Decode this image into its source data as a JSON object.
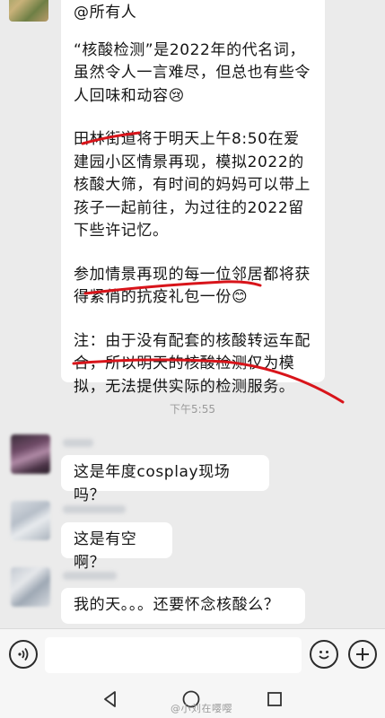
{
  "messages": {
    "announcement": {
      "mention": "@所有人",
      "para1": "“核酸检测”是2022年的代名词，虽然令人一言难尽，但总也有些令人回味和动容😢",
      "para2": "田林街道将于明天上午8:50在爱建园小区情景再现，模拟2022的核酸大筛，有时间的妈妈可以带上孩子一起前往，为过往的2022留下些许记忆。",
      "para3": "参加情景再现的每一位邻居都将获得紧俏的抗疫礼包一份😊",
      "para4": "注：由于没有配套的核酸转运车配合，所以明天的核酸检测仅为模拟，无法提供实际的检测服务。"
    },
    "time_separator": "下午5:55",
    "replies": [
      {
        "text": "这是年度cosplay现场吗？"
      },
      {
        "text": "这是有空啊？"
      },
      {
        "text": "我的天。。。还要怀念核酸么？"
      }
    ]
  },
  "input_bar": {
    "voice_icon": "voice-icon",
    "emoji_icon": "smiley-icon",
    "plus_icon": "plus-icon",
    "placeholder": ""
  },
  "nav_bar": {
    "back_icon": "triangle-back-icon",
    "home_icon": "circle-home-icon",
    "recent_icon": "square-recent-icon"
  },
  "watermark": "@小刘在嘤嘤",
  "colors": {
    "background": "#ebebeb",
    "bubble": "#ffffff",
    "annotation_red": "#d8141a"
  }
}
